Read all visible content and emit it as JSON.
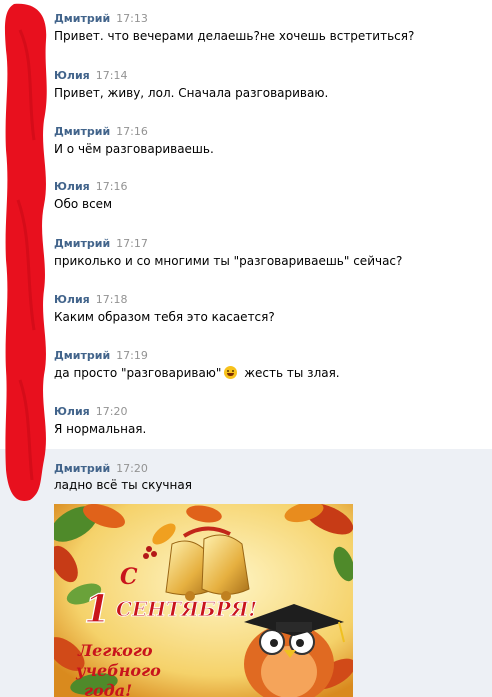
{
  "messages": [
    {
      "author": "Дмитрий",
      "time": "17:13",
      "text": "Привет. что вечерами делаешь?не хочешь встретиться?"
    },
    {
      "author": "Юлия",
      "time": "17:14",
      "text": "Привет, живу, лол. Сначала разговариваю."
    },
    {
      "author": "Дмитрий",
      "time": "17:16",
      "text": "И о чём разговариваешь."
    },
    {
      "author": "Юлия",
      "time": "17:16",
      "text": "Обо всем"
    },
    {
      "author": "Дмитрий",
      "time": "17:17",
      "text": "приколько и со многими ты \"разговариваешь\" сейчас?"
    },
    {
      "author": "Юлия",
      "time": "17:18",
      "text": "Каким образом тебя это касается?"
    },
    {
      "author": "Дмитрий",
      "time": "17:19",
      "text_before": "да просто \"разговариваю\"",
      "text_after": " жесть ты злая.",
      "emoji": "grinning-face-emoji"
    },
    {
      "author": "Юлия",
      "time": "17:20",
      "text": "Я нормальная."
    },
    {
      "author": "Дмитрий",
      "time": "17:20",
      "text": "ладно всё ты скучная"
    }
  ],
  "postcard": {
    "line1": "С",
    "line2": "1",
    "line3": "СЕНТЯБРЯ!",
    "line4": "Легкого",
    "line5": "учебного",
    "line6": "года!"
  },
  "colors": {
    "author": "#42648b",
    "time": "#939393",
    "highlight": "#edf0f5",
    "scribble": "#e8101e"
  }
}
